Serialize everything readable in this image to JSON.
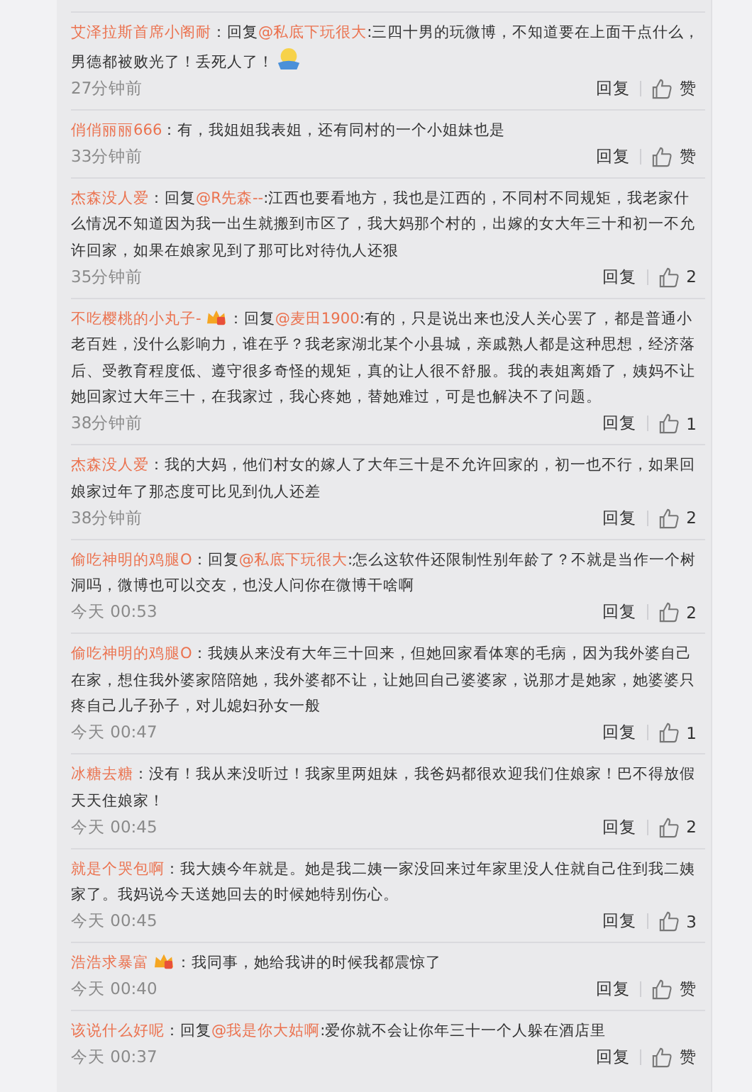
{
  "comments": [
    {
      "user": "艾泽拉斯首席小阁耐",
      "badge": false,
      "lead": "：回复",
      "reply_to": "@私底下玩很大",
      "text": ":三四十男的玩微博，不知道要在上面干点什么，男德都被败光了！丢死人了！",
      "emoji": true,
      "time": "27分钟前",
      "reply": "回复",
      "likes": "赞"
    },
    {
      "user": "俏俏丽丽666",
      "badge": false,
      "lead": "：有，我姐姐我表姐，还有同村的一个小姐妹也是",
      "emoji": false,
      "time": "33分钟前",
      "reply": "回复",
      "likes": "赞"
    },
    {
      "user": "杰森没人爱",
      "badge": false,
      "lead": "：回复",
      "reply_to": "@R先森--",
      "text": ":江西也要看地方，我也是江西的，不同村不同规矩，我老家什么情况不知道因为我一出生就搬到市区了，我大妈那个村的，出嫁的女大年三十和初一不允许回家，如果在娘家见到了那可比对待仇人还狠",
      "emoji": false,
      "time": "35分钟前",
      "reply": "回复",
      "likes": "2"
    },
    {
      "user": "不吃樱桃的小丸子-",
      "badge": true,
      "lead": "：回复",
      "reply_to": "@麦田1900",
      "text": ":有的，只是说出来也没人关心罢了，都是普通小老百姓，没什么影响力，谁在乎？我老家湖北某个小县城，亲戚熟人都是这种思想，经济落后、受教育程度低、遵守很多奇怪的规矩，真的让人很不舒服。我的表姐离婚了，姨妈不让她回家过大年三十，在我家过，我心疼她，替她难过，可是也解决不了问题。",
      "emoji": false,
      "time": "38分钟前",
      "reply": "回复",
      "likes": "1"
    },
    {
      "user": "杰森没人爱",
      "badge": false,
      "lead": "：我的大妈，他们村女的嫁人了大年三十是不允许回家的，初一也不行，如果回娘家过年了那态度可比见到仇人还差",
      "emoji": false,
      "time": "38分钟前",
      "reply": "回复",
      "likes": "2"
    },
    {
      "user": "偷吃神明的鸡腿O",
      "badge": false,
      "lead": "：回复",
      "reply_to": "@私底下玩很大",
      "text": ":怎么这软件还限制性别年龄了？不就是当作一个树洞吗，微博也可以交友，也没人问你在微博干啥啊",
      "emoji": false,
      "time": "今天 00:53",
      "reply": "回复",
      "likes": "2"
    },
    {
      "user": "偷吃神明的鸡腿O",
      "badge": false,
      "lead": "：我姨从来没有大年三十回来，但她回家看体寒的毛病，因为我外婆自己在家，想住我外婆家陪陪她，我外婆都不让，让她回自己婆婆家，说那才是她家，她婆婆只疼自己儿子孙子，对儿媳妇孙女一般",
      "emoji": false,
      "time": "今天 00:47",
      "reply": "回复",
      "likes": "1"
    },
    {
      "user": "冰糖去糖",
      "badge": false,
      "lead": "：没有！我从来没听过！我家里两姐妹，我爸妈都很欢迎我们住娘家！巴不得放假天天住娘家！",
      "emoji": false,
      "time": "今天 00:45",
      "reply": "回复",
      "likes": "2"
    },
    {
      "user": "就是个哭包啊",
      "badge": false,
      "lead": "：我大姨今年就是。她是我二姨一家没回来过年家里没人住就自己住到我二姨家了。我妈说今天送她回去的时候她特别伤心。",
      "emoji": false,
      "time": "今天 00:45",
      "reply": "回复",
      "likes": "3"
    },
    {
      "user": "浩浩求暴富",
      "badge": true,
      "lead": "：我同事，她给我讲的时候我都震惊了",
      "emoji": false,
      "time": "今天 00:40",
      "reply": "回复",
      "likes": "赞"
    },
    {
      "user": "该说什么好呢",
      "badge": false,
      "lead": "：回复",
      "reply_to": "@我是你大姑啊",
      "text": ":爱你就不会让你年三十一个人躲在酒店里",
      "emoji": false,
      "time": "今天 00:37",
      "reply": "回复",
      "likes": "赞"
    }
  ]
}
